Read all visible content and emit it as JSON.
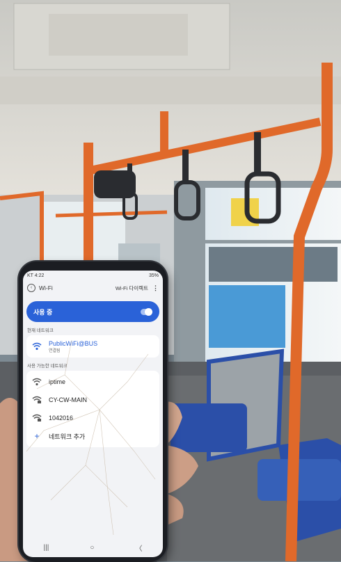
{
  "status_bar": {
    "carrier": "KT 4:22",
    "battery": "35%"
  },
  "app_bar": {
    "title": "Wi-Fi",
    "direct_label": "Wi-Fi 다이렉트"
  },
  "toggle": {
    "label": "사용 중",
    "on": true
  },
  "current_section": {
    "header": "현재 네트워크",
    "network": {
      "name": "PublicWiFi@BUS",
      "status": "연결됨"
    }
  },
  "available_section": {
    "header": "사용 가능한 네트워크",
    "networks": [
      {
        "name": "iptime",
        "secured": false
      },
      {
        "name": "CY-CW-MAIN",
        "secured": true
      },
      {
        "name": "1042016",
        "secured": true
      }
    ],
    "add_label": "네트워크 추가"
  },
  "nav_bar": {
    "recent": "|||",
    "home": "○",
    "back": "〈"
  },
  "colors": {
    "accent": "#2a62d8",
    "pole": "#e0692a",
    "seat": "#2b4fa8"
  }
}
